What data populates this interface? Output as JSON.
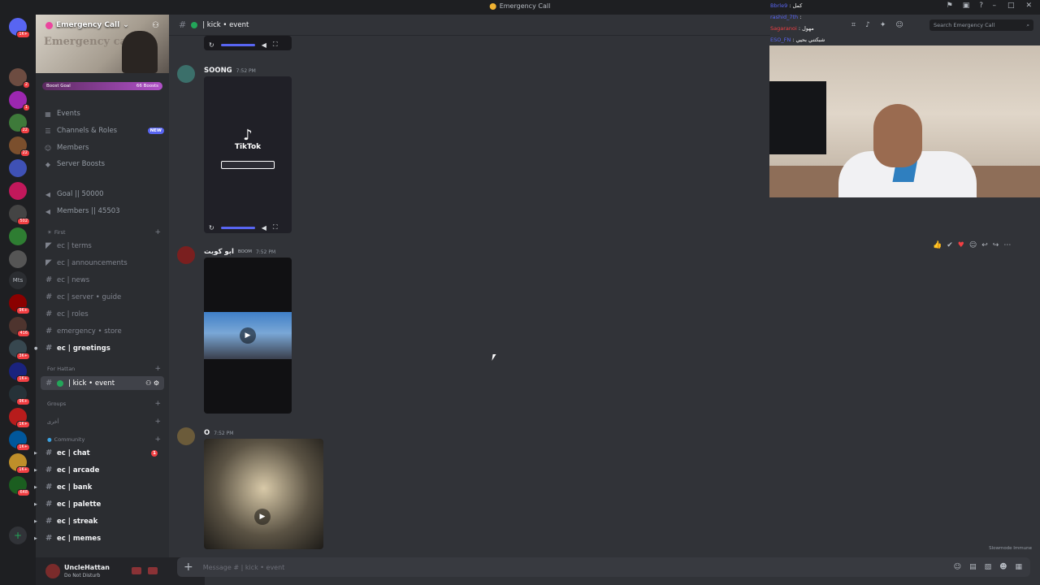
{
  "window": {
    "title": "Emergency Call"
  },
  "server": {
    "name": "Emergency Call",
    "banner_text": "Emergency call",
    "boost_goal_label": "Boost Goal",
    "boost_count": "66 Boosts"
  },
  "nav": [
    {
      "label": "Events",
      "icon": "calendar-icon"
    },
    {
      "label": "Channels & Roles",
      "icon": "list-icon",
      "badge": "NEW"
    },
    {
      "label": "Members",
      "icon": "members-icon"
    },
    {
      "label": "Server Boosts",
      "icon": "boost-icon"
    }
  ],
  "stats": [
    {
      "label": "Goal || 50000"
    },
    {
      "label": "Members || 45503"
    }
  ],
  "categories": {
    "first": "First",
    "for_hattan": "For Hattan",
    "groups": "Groups",
    "other": "أخرى",
    "community": "Community"
  },
  "channels_first": [
    {
      "name": "ec | terms"
    },
    {
      "name": "ec | announcements"
    },
    {
      "name": "ec | news"
    },
    {
      "name": "ec | server • guide"
    },
    {
      "name": "ec | roles"
    },
    {
      "name": "emergency • store"
    },
    {
      "name": "ec | greetings"
    }
  ],
  "active_channel": {
    "name": "| kick • event"
  },
  "channels_community": [
    {
      "name": "ec | chat",
      "unread": "1"
    },
    {
      "name": "ec | arcade"
    },
    {
      "name": "ec | bank"
    },
    {
      "name": "ec | palette"
    },
    {
      "name": "ec | streak"
    },
    {
      "name": "ec | memes"
    }
  ],
  "user": {
    "name": "UncleHattan",
    "status": "Do Not Disturb"
  },
  "header": {
    "channel": "| kick • event",
    "search_placeholder": "Search Emergency Call"
  },
  "messages": [
    {
      "author": "SOONG",
      "time": "7:52 PM",
      "media": "TikTok"
    },
    {
      "author": "ابو كويت",
      "role": "BOOM",
      "time": "7:52 PM"
    },
    {
      "author": "O",
      "time": "7:52 PM"
    }
  ],
  "composer": {
    "placeholder": "Message #  | kick • event"
  },
  "slowmode": "Slowmode Immune",
  "server_badges": [
    "1K+",
    "2",
    "1",
    "22",
    "22",
    "502",
    "9K+",
    "416",
    "3K+",
    "1K+",
    "9K+",
    "1K+",
    "1K+",
    "648"
  ],
  "overlay_chat": [
    {
      "name": "Bbrle9",
      "text": ": كمل"
    },
    {
      "name": "rashid_7th",
      "text": ":"
    },
    {
      "name": "Sagaranoi",
      "text": ": مهول"
    },
    {
      "name": "ESO_FN",
      "text": ": شبكتني بحيي"
    }
  ],
  "colors": {
    "accent": "#5865f2",
    "online": "#23a559",
    "danger": "#f23f43",
    "background": "#313338"
  }
}
